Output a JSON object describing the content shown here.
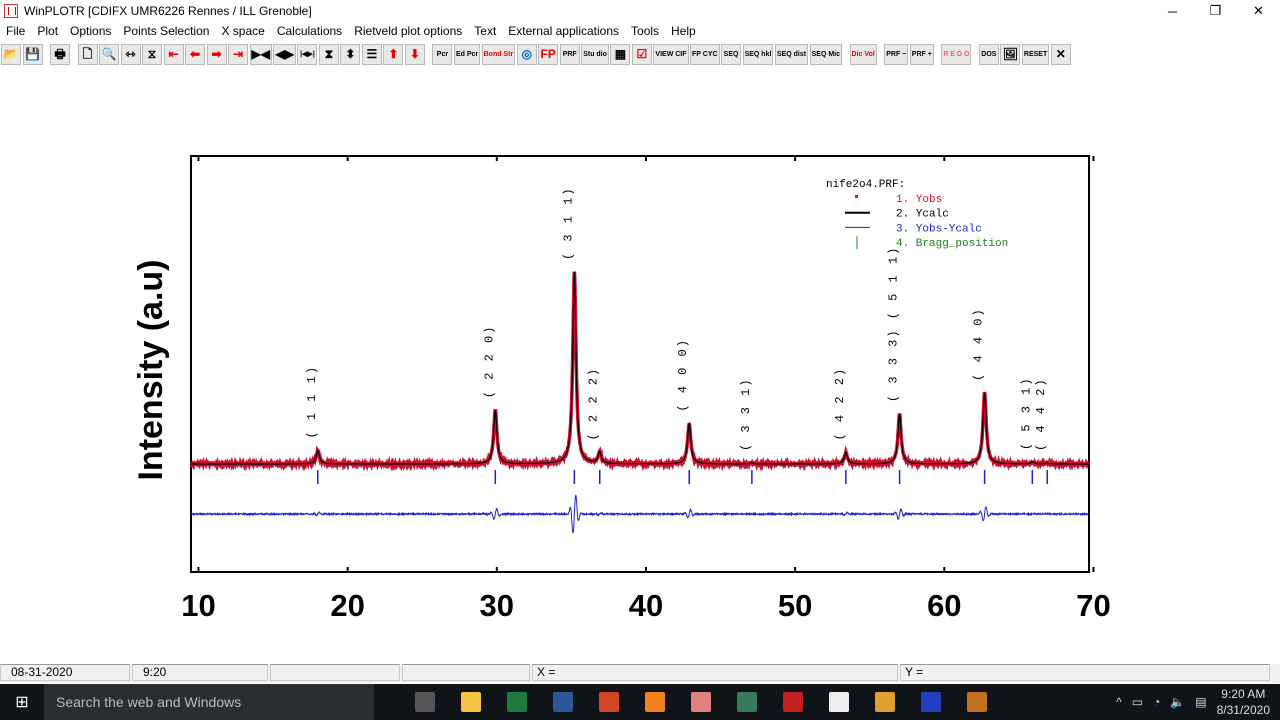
{
  "window": {
    "title": "WinPLOTR [CDIFX UMR6226 Rennes / ILL Grenoble]",
    "minimize": "─",
    "restore": "❐",
    "close": "✕"
  },
  "menu": [
    "File",
    "Plot",
    "Options",
    "Points Selection",
    "X space",
    "Calculations",
    "Rietveld plot options",
    "Text",
    "External applications",
    "Tools",
    "Help"
  ],
  "toolbar": [
    {
      "icon": "open-folder-icon",
      "label": "📂"
    },
    {
      "icon": "save-icon",
      "label": "💾"
    },
    {
      "gap": true
    },
    {
      "icon": "print-icon",
      "label": "🖶"
    },
    {
      "gap": true
    },
    {
      "icon": "preview-icon",
      "label": "🗋"
    },
    {
      "icon": "zoom-icon",
      "label": "🔍"
    },
    {
      "icon": "expand-horizontal-icon",
      "label": "⇿"
    },
    {
      "icon": "fit-icon",
      "label": "⧖"
    },
    {
      "icon": "first-icon",
      "label": "⇤",
      "color": "#e00"
    },
    {
      "icon": "left-icon",
      "label": "⬅",
      "color": "#e00"
    },
    {
      "icon": "right-icon",
      "label": "➡",
      "color": "#e00"
    },
    {
      "icon": "last-icon",
      "label": "⇥",
      "color": "#e00"
    },
    {
      "icon": "compress-x-icon",
      "label": "▶◀"
    },
    {
      "icon": "expand-x-icon",
      "label": "◀▶"
    },
    {
      "icon": "reset-x-icon",
      "label": "|◀▶|"
    },
    {
      "icon": "compress-y-icon",
      "label": "⧗"
    },
    {
      "icon": "expand-y-icon",
      "label": "⬍"
    },
    {
      "icon": "fit-y-icon",
      "label": "☰"
    },
    {
      "icon": "up-icon",
      "label": "⬆",
      "color": "#e00"
    },
    {
      "icon": "down-icon",
      "label": "⬇",
      "color": "#e00"
    },
    {
      "gap": true
    },
    {
      "icon": "pcr-icon",
      "label": "Pcr"
    },
    {
      "icon": "edit-pcr-icon",
      "label": "Ed Pcr"
    },
    {
      "icon": "bond-str-icon",
      "label": "Bond Str",
      "color": "#e00"
    },
    {
      "icon": "target-icon",
      "label": "◎",
      "color": "#06c"
    },
    {
      "icon": "fp-icon",
      "label": "FP",
      "color": "#e00"
    },
    {
      "icon": "prf-icon",
      "label": "PRF"
    },
    {
      "icon": "studio-icon",
      "label": "Stu dio"
    },
    {
      "icon": "grid-icon",
      "label": "▦"
    },
    {
      "icon": "check-icon",
      "label": "☑",
      "color": "#e00"
    },
    {
      "icon": "view-cif-icon",
      "label": "VIEW CIF"
    },
    {
      "icon": "fp-cyc-icon",
      "label": "FP CYC"
    },
    {
      "icon": "seq-icon",
      "label": "SEQ"
    },
    {
      "icon": "seq-hkl-icon",
      "label": "SEQ hkl"
    },
    {
      "icon": "seq-dist-icon",
      "label": "SEQ dist"
    },
    {
      "icon": "seq-mic-icon",
      "label": "SEQ Mic"
    },
    {
      "gap": true
    },
    {
      "icon": "dicvol-icon",
      "label": "Dic Vol",
      "color": "#e00"
    },
    {
      "gap": true
    },
    {
      "icon": "prf-minus-icon",
      "label": "PRF −"
    },
    {
      "icon": "prf-plus-icon",
      "label": "PRF +"
    },
    {
      "gap": true
    },
    {
      "icon": "redo-icon",
      "label": "R E D O",
      "color": "#e66"
    },
    {
      "gap": true
    },
    {
      "icon": "dos-icon",
      "label": "DOS"
    },
    {
      "icon": "picture-icon",
      "label": "🖼"
    },
    {
      "icon": "reset-icon",
      "label": "RESET"
    },
    {
      "icon": "close-icon",
      "label": "✕"
    }
  ],
  "chart_data": {
    "type": "line",
    "title": "",
    "xlabel": "",
    "ylabel": "Intensity (a.u)",
    "xlim": [
      9.5,
      69.7
    ],
    "xticks": [
      10,
      20,
      30,
      40,
      50,
      60,
      70
    ],
    "grid": false,
    "legend": {
      "placement": "top-right",
      "file": "nife2o4.PRF:",
      "entries": [
        {
          "label": "1. Yobs",
          "color": "#e0102a",
          "marker": "dot"
        },
        {
          "label": "2. Ycalc",
          "color": "#000000",
          "marker": "line"
        },
        {
          "label": "3. Yobs-Ycalc",
          "color": "#2020d0",
          "marker": "line"
        },
        {
          "label": "4. Bragg_position",
          "color": "#208020",
          "marker": "tick"
        }
      ]
    },
    "peaks": [
      {
        "hkl": "( 1 1 1)",
        "two_theta": 18.0,
        "relative_intensity": 7
      },
      {
        "hkl": "( 2 2 0)",
        "two_theta": 29.9,
        "relative_intensity": 28
      },
      {
        "hkl": "( 3 1 1)",
        "two_theta": 35.2,
        "relative_intensity": 100
      },
      {
        "hkl": "( 2 2 2)",
        "two_theta": 36.9,
        "relative_intensity": 6
      },
      {
        "hkl": "( 4 0 0)",
        "two_theta": 42.9,
        "relative_intensity": 21
      },
      {
        "hkl": "( 3 3 1)",
        "two_theta": 47.1,
        "relative_intensity": 0.5
      },
      {
        "hkl": "( 4 2 2)",
        "two_theta": 53.4,
        "relative_intensity": 6
      },
      {
        "hkl": "( 3 3 3) ( 5 1 1)",
        "two_theta": 57.0,
        "relative_intensity": 26
      },
      {
        "hkl": "( 4 4 0)",
        "two_theta": 62.7,
        "relative_intensity": 37
      },
      {
        "hkl": "( 5 3 1)",
        "two_theta": 65.9,
        "relative_intensity": 1
      },
      {
        "hkl": "( 4 4 2)",
        "two_theta": 66.9,
        "relative_intensity": 0.5
      }
    ]
  },
  "status": {
    "date": "08-31-2020",
    "time": "9:20",
    "x": "X =",
    "y": "Y ="
  },
  "taskbar": {
    "search": "Search the web and Windows",
    "clock_time": "9:20 AM",
    "clock_date": "8/31/2020",
    "apps": [
      {
        "name": "task-view",
        "color": "#555"
      },
      {
        "name": "file-explorer",
        "color": "#f4c542"
      },
      {
        "name": "excel",
        "color": "#1f7a3f"
      },
      {
        "name": "word",
        "color": "#2b5797"
      },
      {
        "name": "powerpoint",
        "color": "#d04525"
      },
      {
        "name": "app-orange",
        "color": "#f08020"
      },
      {
        "name": "app-pink",
        "color": "#e08080"
      },
      {
        "name": "eps-toolbar",
        "color": "#3a7a5a"
      },
      {
        "name": "winplotr",
        "color": "#c02020"
      },
      {
        "name": "photos",
        "color": "#eee"
      },
      {
        "name": "app-fan",
        "color": "#e0a030"
      },
      {
        "name": "gfourier",
        "color": "#2040c0"
      },
      {
        "name": "bond-str",
        "color": "#c07020"
      }
    ]
  }
}
